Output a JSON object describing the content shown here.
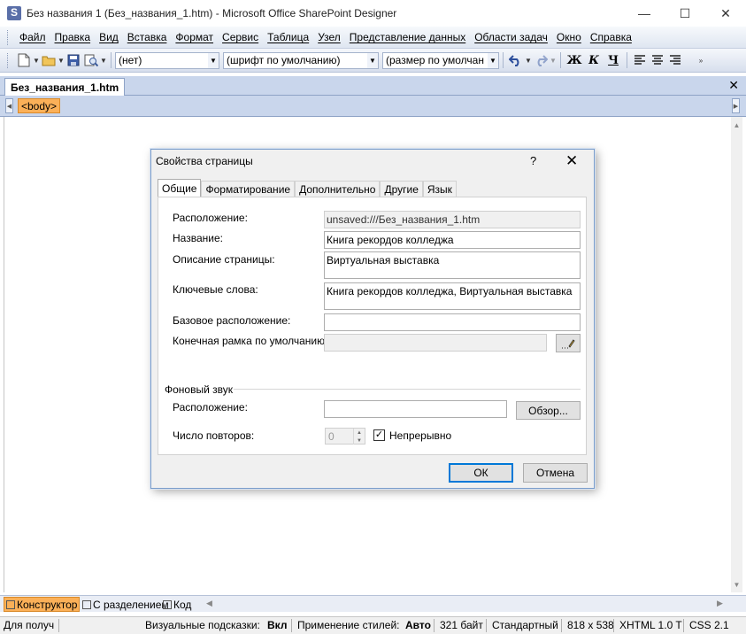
{
  "window": {
    "title": "Без названия 1 (Без_названия_1.htm) - Microsoft Office SharePoint Designer",
    "minimize_glyph": "—",
    "maximize_glyph": "☐",
    "close_glyph": "✕"
  },
  "menu": [
    "Файл",
    "Правка",
    "Вид",
    "Вставка",
    "Формат",
    "Сервис",
    "Таблица",
    "Узел",
    "Представление данных",
    "Области задач",
    "Окно",
    "Справка"
  ],
  "toolbar": {
    "style_combo": "(нет)",
    "font_combo": "(шрифт по умолчанию)",
    "size_combo": "(размер по умолчан",
    "bold_label": "Ж",
    "italic_label": "К",
    "underline_label": "Ч",
    "icons": [
      "new-document-icon",
      "open-folder-icon",
      "save-icon",
      "preview-icon",
      "undo-icon",
      "redo-icon",
      "align-left-icon",
      "align-center-icon",
      "align-right-icon"
    ]
  },
  "document_tab": {
    "label": "Без_названия_1.htm",
    "close_glyph": "✕"
  },
  "tag_selector": {
    "tag": "<body>"
  },
  "dialog": {
    "title": "Свойства страницы",
    "help_glyph": "?",
    "close_glyph": "✕",
    "tabs": [
      "Общие",
      "Форматирование",
      "Дополнительно",
      "Другие",
      "Язык"
    ],
    "active_tab": "Общие",
    "location_label": "Расположение:",
    "location_value": "unsaved:///Без_названия_1.htm",
    "title_label": "Название:",
    "title_value": "Книга рекордов колледжа",
    "description_label": "Описание страницы:",
    "description_value": "Виртуальная выставка",
    "keywords_label": "Ключевые слова:",
    "keywords_value": "Книга рекордов колледжа, Виртуальная выставка",
    "base_location_label": "Базовое расположение:",
    "base_location_value": "",
    "default_frame_label": "Конечная рамка по умолчанию:",
    "default_frame_value": "",
    "bg_sound_section": "Фоновый звук",
    "sound_location_label": "Расположение:",
    "sound_location_value": "",
    "browse_button": "Обзор...",
    "loop_label": "Число повторов:",
    "loop_value": "0",
    "continuous_label": "Непрерывно",
    "continuous_checked": true,
    "ok_button": "ОК",
    "cancel_button": "Отмена"
  },
  "view_tabs": [
    "Конструктор",
    "С разделением",
    "Код"
  ],
  "active_view": "Конструктор",
  "status": {
    "left_text": "Для получ",
    "hints_label": "Визуальные подсказки:",
    "hints_value": "Вкл",
    "styles_label": "Применение стилей:",
    "styles_value": "Авто",
    "size": "321 байт",
    "mode": "Стандартный",
    "dimensions": "818 x 538",
    "doctype": "XHTML 1.0 T",
    "css": "CSS 2.1"
  },
  "colors": {
    "accent_orange": "#fbb058",
    "tab_strip_blue": "#c9d6ec",
    "dialog_border": "#7a9cc9"
  }
}
